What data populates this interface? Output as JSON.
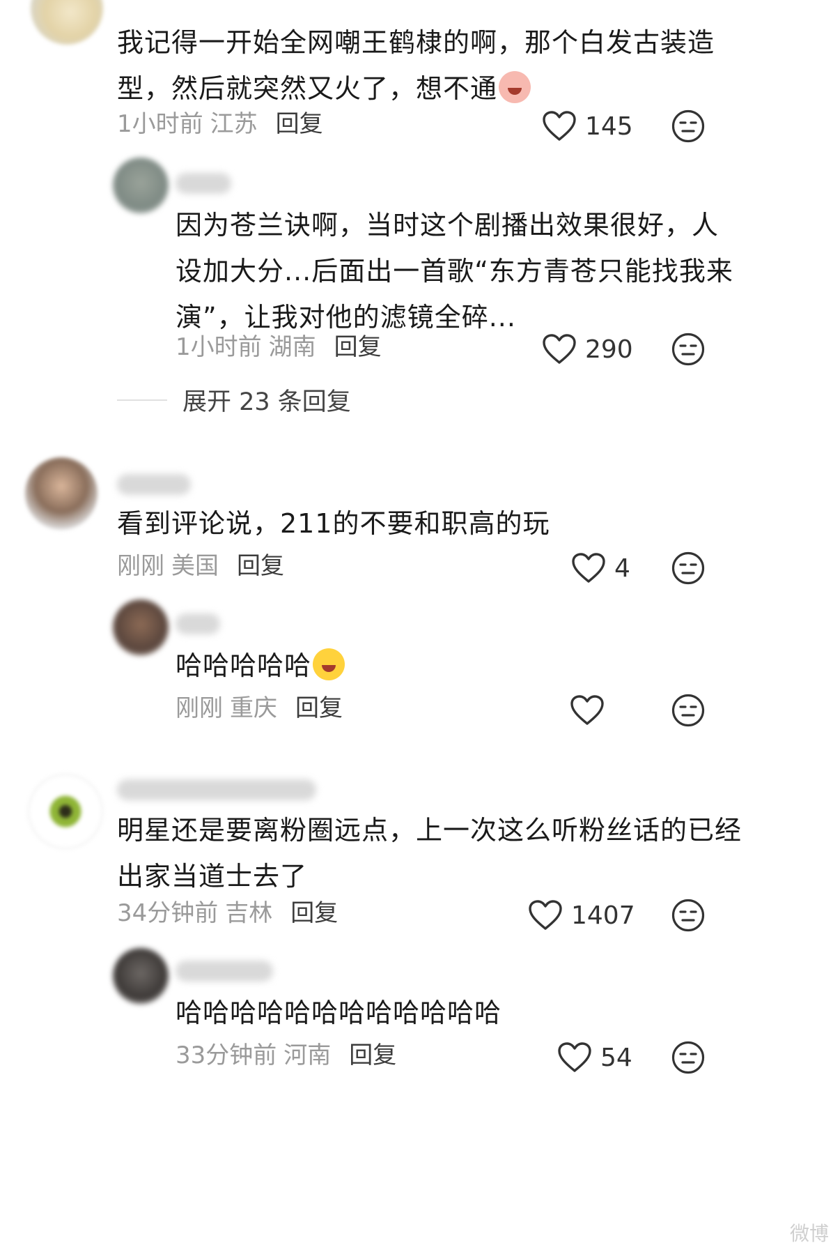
{
  "comments": [
    {
      "text_lines": [
        "我记得一开始全网嘲王鹤棣的啊，那个白发古装造",
        "型，然后就突然又火了，想不通"
      ],
      "time": "1小时前",
      "location": "江苏",
      "reply_label": "回复",
      "likes": "145",
      "replies": [
        {
          "text_lines": [
            "因为苍兰诀啊，当时这个剧播出效果很好，人",
            "设加大分...后面出一首歌“东方青苍只能找我来",
            "演”，让我对他的滤镜全碎..."
          ],
          "time": "1小时前",
          "location": "湖南",
          "reply_label": "回复",
          "likes": "290"
        }
      ],
      "expand_label": "展开 23 条回复"
    },
    {
      "text_lines": [
        "看到评论说，211的不要和职高的玩"
      ],
      "time": "刚刚",
      "location": "美国",
      "reply_label": "回复",
      "likes": "4",
      "replies": [
        {
          "text_lines": [
            "哈哈哈哈哈"
          ],
          "time": "刚刚",
          "location": "重庆",
          "reply_label": "回复",
          "likes": ""
        }
      ]
    },
    {
      "text_lines": [
        "明星还是要离粉圈远点，上一次这么听粉丝话的已经",
        "出家当道士去了"
      ],
      "time": "34分钟前",
      "location": "吉林",
      "reply_label": "回复",
      "likes": "1407",
      "replies": [
        {
          "text_lines": [
            "哈哈哈哈哈哈哈哈哈哈哈哈"
          ],
          "time": "33分钟前",
          "location": "河南",
          "reply_label": "回复",
          "likes": "54"
        }
      ]
    }
  ],
  "watermark": "微博",
  "colors": {
    "text": "#1a1a1a",
    "meta": "#9a9a9a",
    "icon_stroke": "#333333"
  },
  "icons": {
    "like": "heart-outline-icon",
    "dislike": "meh-face-icon",
    "cry_emoji": "crying-emoji-icon",
    "laugh_emoji": "laughing-tears-emoji-icon"
  }
}
